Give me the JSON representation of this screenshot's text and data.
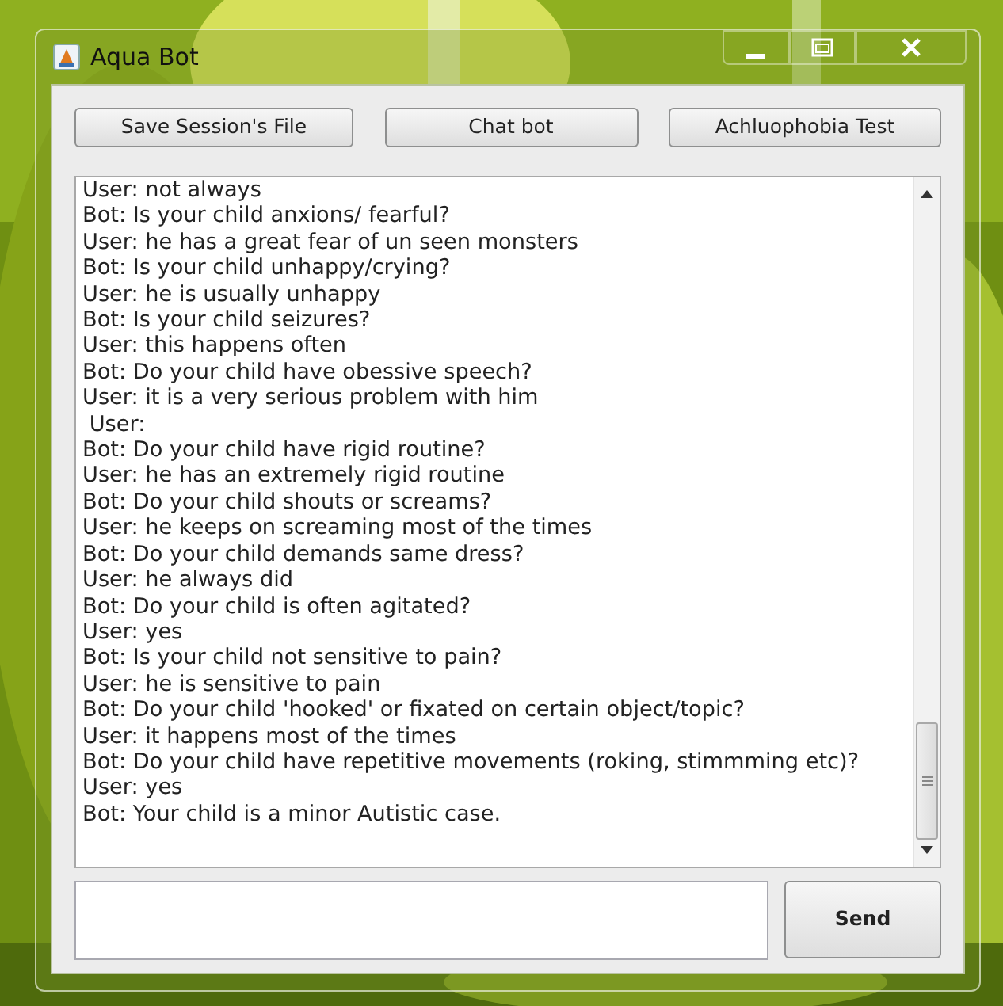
{
  "window": {
    "title": "Aqua Bot"
  },
  "toolbar": [
    "Save Session's File",
    "Chat bot",
    "Achluophobia Test"
  ],
  "transcript": [
    "User: not always",
    "Bot: Is your child anxions/ fearful?",
    "User: he has a great fear of un seen monsters",
    "Bot: Is your child unhappy/crying?",
    "User: he is usually unhappy",
    "Bot: Is your child seizures?",
    "User: this happens often",
    "Bot: Do your child have obessive speech?",
    "User: it is a very serious problem with him",
    " User:",
    "Bot: Do your child have rigid routine?",
    "User: he has an extremely rigid routine",
    "Bot: Do your child shouts or screams?",
    "User: he keeps on screaming most of the times",
    "Bot: Do your child demands same dress?",
    "User: he always did",
    "Bot: Do your child is often agitated?",
    "User: yes",
    "Bot: Is your child not sensitive to pain?",
    "User: he is sensitive to pain",
    "Bot: Do your child 'hooked' or fixated on certain object/topic?",
    "User: it happens most of the times",
    "Bot: Do your child have repetitive movements (roking, stimmming etc)?",
    "User: yes",
    "Bot: Your child is a minor Autistic case."
  ],
  "send_button": "Send"
}
